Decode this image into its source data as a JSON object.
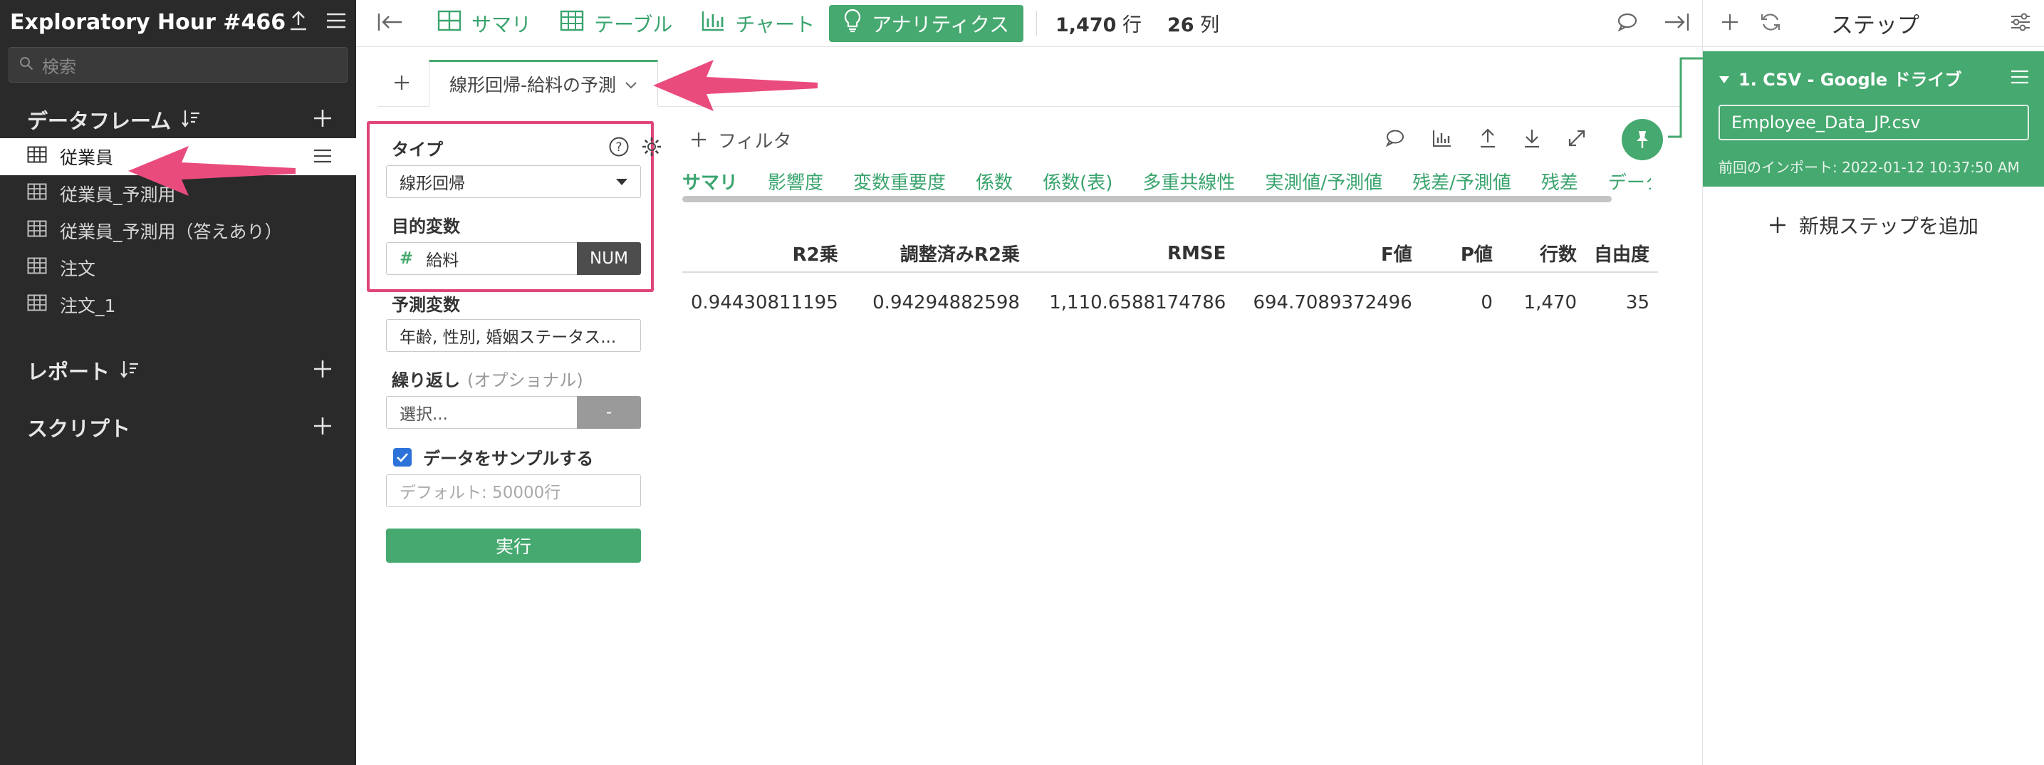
{
  "colors": {
    "accent": "#46a96f",
    "highlight": "#e0457a",
    "sidebar_bg": "#2a2a2a",
    "num_addon": "#4d4d4d",
    "checkbox": "#2d72d9"
  },
  "sidebar": {
    "title": "Exploratory Hour #466",
    "search_placeholder": "検索",
    "sections": {
      "dataframes": "データフレーム",
      "reports": "レポート",
      "scripts": "スクリプト"
    },
    "dataframes": [
      {
        "label": "従業員",
        "active": true
      },
      {
        "label": "従業員_予測用"
      },
      {
        "label": "従業員_予測用（答えあり）"
      },
      {
        "label": "注文"
      },
      {
        "label": "注文_1"
      }
    ]
  },
  "toolbar": {
    "summary": "サマリ",
    "table": "テーブル",
    "chart": "チャート",
    "analytics": "アナリティクス",
    "rows_value": "1,470",
    "rows_unit": "行",
    "cols_value": "26",
    "cols_unit": "列"
  },
  "tabs": {
    "current": "線形回帰-給料の予測"
  },
  "panel": {
    "type_label": "タイプ",
    "type_value": "線形回帰",
    "target_label": "目的変数",
    "target_value": "給料",
    "target_type": "NUM",
    "predictors_label": "予測変数",
    "predictors_value": "年齢, 性別, 婚姻ステータス...",
    "repeat_label": "繰り返し",
    "repeat_optional": "(オプショナル)",
    "repeat_placeholder": "選択...",
    "repeat_addon": "-",
    "sample_label": "データをサンプルする",
    "sample_placeholder": "デフォルト: 50000行",
    "run_label": "実行"
  },
  "results": {
    "filter_label": "フィルタ",
    "subtabs": [
      "サマリ",
      "影響度",
      "変数重要度",
      "係数",
      "係数(表)",
      "多重共線性",
      "実測値/予測値",
      "残差/予測値",
      "残差",
      "データ"
    ],
    "table": {
      "headers": [
        "R2乗",
        "調整済みR2乗",
        "RMSE",
        "F値",
        "P値",
        "行数",
        "自由度"
      ],
      "rows": [
        [
          "0.94430811195",
          "0.94294882598",
          "1,110.6588174786",
          "694.7089372496",
          "0",
          "1,470",
          "35"
        ]
      ]
    }
  },
  "steps": {
    "title": "ステップ",
    "step1_title": "1. CSV - Google ドライブ",
    "step1_file": "Employee_Data_JP.csv",
    "step1_time": "前回のインポート: 2022-01-12 10:37:50 AM",
    "add_step": "新規ステップを追加"
  }
}
